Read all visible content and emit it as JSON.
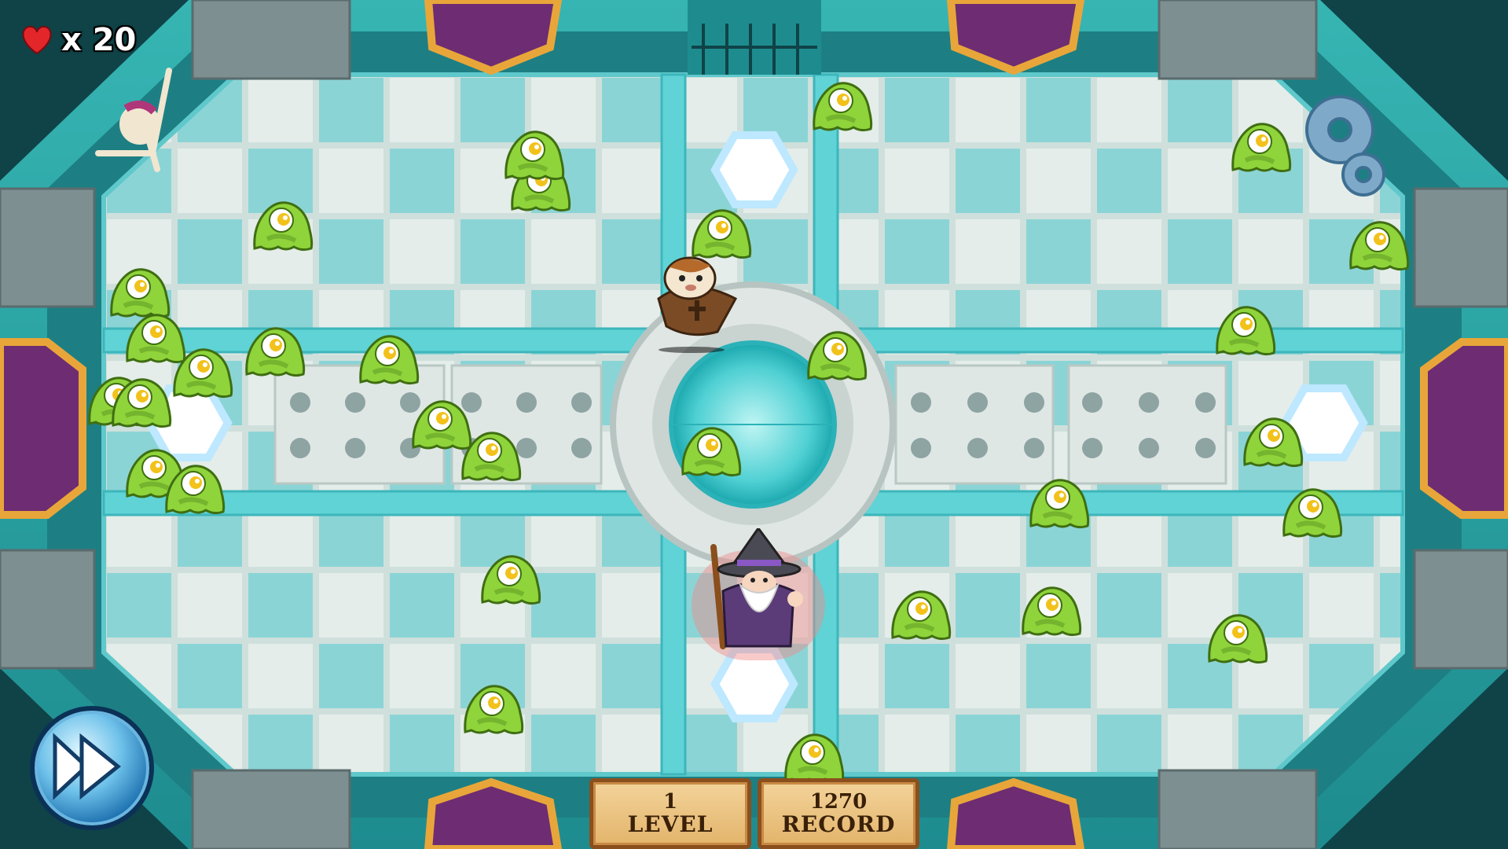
{
  "hud": {
    "lives_count": "x 20",
    "level_value": "1",
    "level_label": "LEVEL",
    "record_value": "1270",
    "record_label": "RECORD"
  },
  "icons": {
    "lives": "heart-icon",
    "dash": "fast-forward-icon"
  },
  "colors": {
    "slime": "#8fd43a",
    "floor_teal": "#7fd2d6",
    "floor_light": "#e3ece8",
    "wall": "#2b9fa3",
    "gate": "#6e2c72"
  }
}
